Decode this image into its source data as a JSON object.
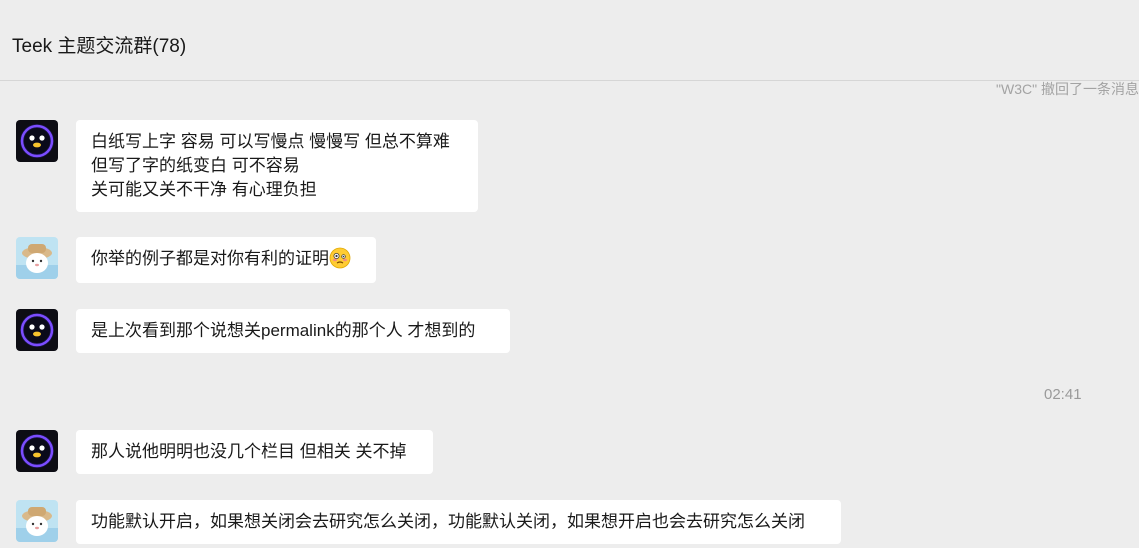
{
  "header": {
    "title": "Teek 主题交流群(78)"
  },
  "system_notice": "\"W3C\" 撤回了一条消息",
  "timestamp": "02:41",
  "messages": [
    {
      "sender_avatar": "robot-avatar",
      "lines": [
        "白纸写上字 容易 可以写慢点 慢慢写 但总不算难",
        "但写了字的纸变白 可不容易",
        "关可能又关不干净 有心理负担"
      ]
    },
    {
      "sender_avatar": "bear-avatar",
      "text": "你举的例子都是对你有利的证明",
      "emoji": "woozy-face-emoji"
    },
    {
      "sender_avatar": "robot-avatar",
      "text": "是上次看到那个说想关permalink的那个人 才想到的"
    },
    {
      "sender_avatar": "robot-avatar",
      "text": "那人说他明明也没几个栏目 但相关 关不掉"
    },
    {
      "sender_avatar": "bear-avatar",
      "text": "功能默认开启，如果想关闭会去研究怎么关闭，功能默认关闭，如果想开启也会去研究怎么关闭"
    }
  ],
  "colors": {
    "background": "#ededed",
    "bubble": "#ffffff",
    "muted_text": "#a3a3a3"
  }
}
